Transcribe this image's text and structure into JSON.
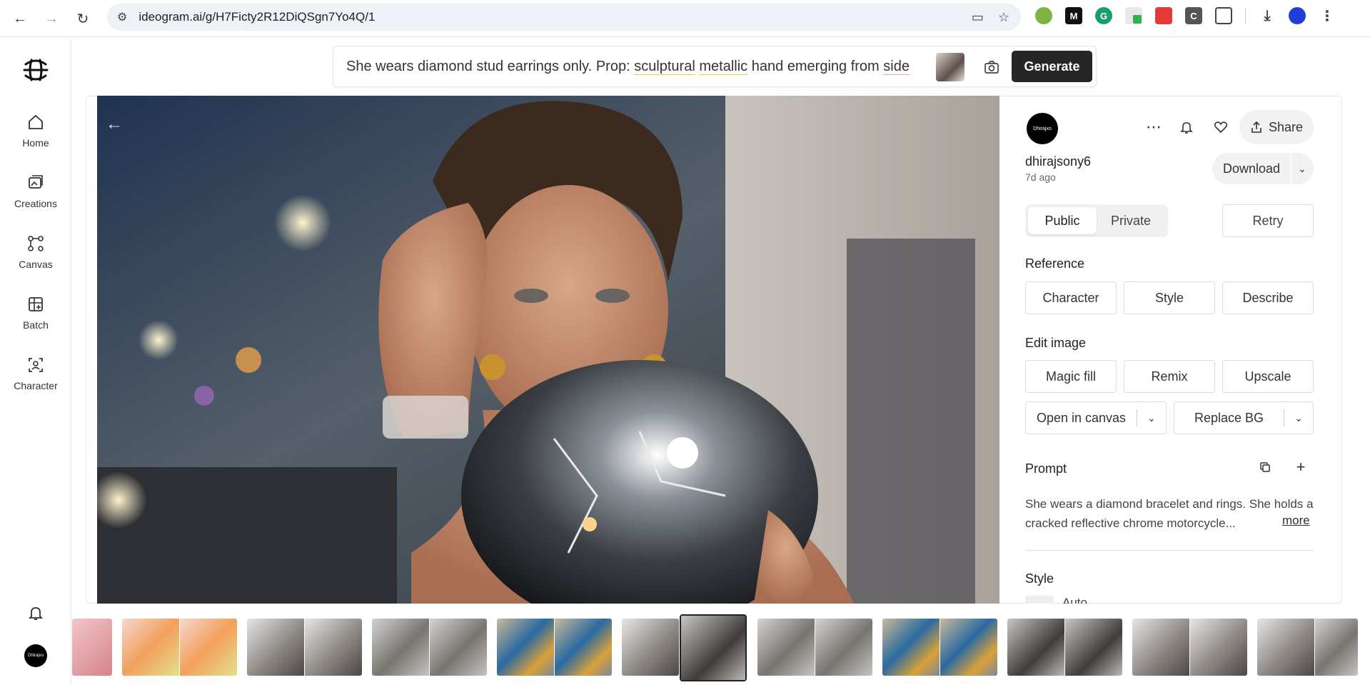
{
  "browser": {
    "url": "ideogram.ai/g/H7Ficty2R12DiQSgn7Yo4Q/1"
  },
  "sidebar": {
    "items": [
      {
        "label": "Home"
      },
      {
        "label": "Creations"
      },
      {
        "label": "Canvas"
      },
      {
        "label": "Batch"
      },
      {
        "label": "Character"
      }
    ]
  },
  "prompt_bar": {
    "text_start": "She wears diamond stud earrings only. Prop: ",
    "word1": "sculptural",
    "word2": "metallic",
    "text_mid": " hand emerging from ",
    "word3": "side",
    "generate_label": "Generate"
  },
  "panel": {
    "owner_avatar_text": "Dhirajxo",
    "owner_name": "dhirajsony6",
    "posted": "7d ago",
    "share_label": "Share",
    "download_label": "Download",
    "visibility": {
      "public": "Public",
      "private": "Private",
      "selected": "Public"
    },
    "retry_label": "Retry",
    "reference_title": "Reference",
    "reference_buttons": [
      "Character",
      "Style",
      "Describe"
    ],
    "edit_title": "Edit image",
    "edit_buttons": [
      "Magic fill",
      "Remix",
      "Upscale"
    ],
    "open_canvas_label": "Open in canvas",
    "replace_bg_label": "Replace BG",
    "prompt_title": "Prompt",
    "prompt_text": "She wears a diamond bracelet and rings. She holds a cracked reflective chrome motorcycle...",
    "more_label": "more",
    "style_title": "Style",
    "style_value": "Auto"
  },
  "colors": {
    "generate_bg": "#262626",
    "share_bg": "#f2f2f2"
  }
}
